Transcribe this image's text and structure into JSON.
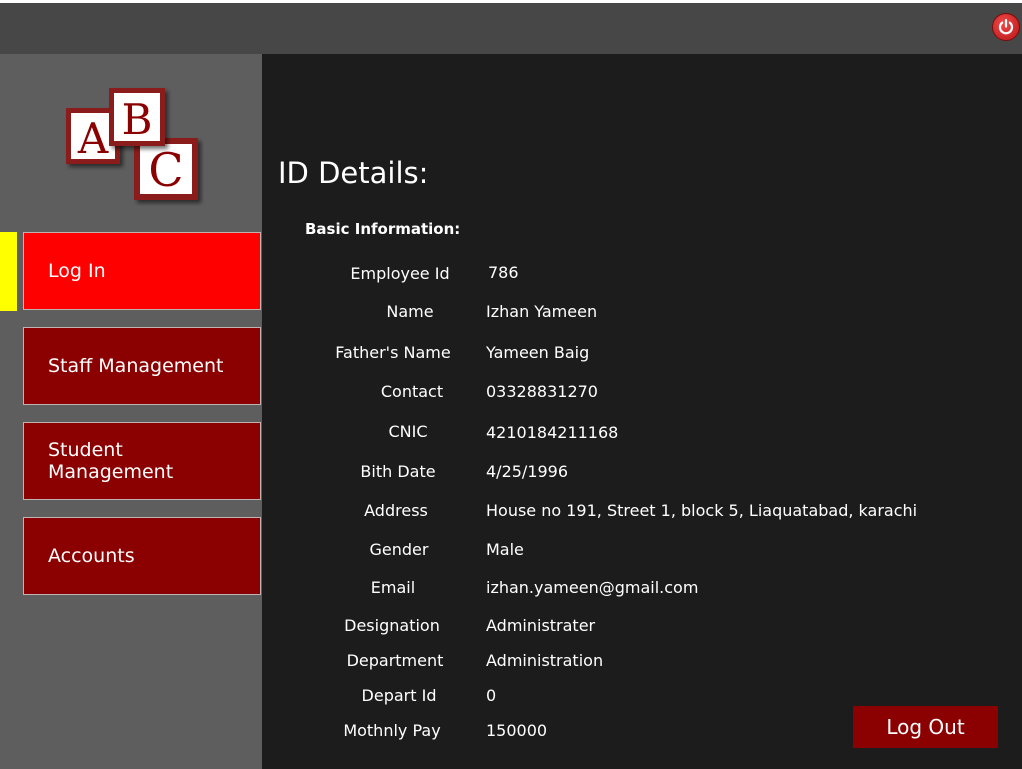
{
  "colors": {
    "topbar": "#474747",
    "sidebar": "#5e5e5e",
    "main_bg": "#1c1c1c",
    "nav_item": "#8b0000",
    "nav_active": "#ff0000",
    "nav_indicator": "#ffff00",
    "logout": "#8b0000"
  },
  "header": {
    "power_icon": "power-icon"
  },
  "logo": {
    "letters": [
      "A",
      "B",
      "C"
    ]
  },
  "sidebar": {
    "items": [
      {
        "label": "Log In",
        "active": true
      },
      {
        "label": "Staff Management",
        "active": false
      },
      {
        "label": "Student Management",
        "active": false
      },
      {
        "label": "Accounts",
        "active": false
      }
    ]
  },
  "main": {
    "title": "ID Details:",
    "section": "Basic Information:",
    "fields": [
      {
        "label": "Employee Id",
        "value": "786"
      },
      {
        "label": "Name",
        "value": "Izhan Yameen"
      },
      {
        "label": "Father's Name",
        "value": "Yameen Baig"
      },
      {
        "label": "Contact",
        "value": "03328831270"
      },
      {
        "label": "CNIC",
        "value": "4210184211168"
      },
      {
        "label": "Bith Date",
        "value": "4/25/1996"
      },
      {
        "label": "Address",
        "value": "House no 191, Street 1, block 5, Liaquatabad, karachi"
      },
      {
        "label": "Gender",
        "value": "Male"
      },
      {
        "label": "Email",
        "value": "izhan.yameen@gmail.com"
      },
      {
        "label": "Designation",
        "value": "Administrater"
      },
      {
        "label": "Department",
        "value": "Administration"
      },
      {
        "label": "Depart Id",
        "value": "0"
      },
      {
        "label": "Mothnly Pay",
        "value": "150000"
      }
    ],
    "logout_label": "Log Out"
  }
}
